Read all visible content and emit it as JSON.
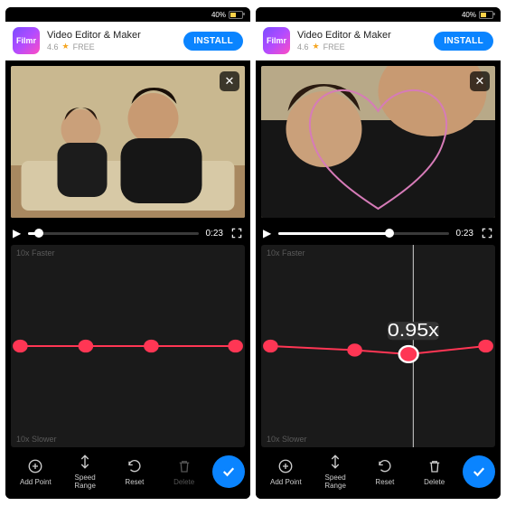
{
  "status": {
    "batteryPct": "40%"
  },
  "ad": {
    "iconText": "Filmr",
    "title": "Video Editor & Maker",
    "rating": "4.6",
    "price": "FREE",
    "cta": "INSTALL",
    "adInfo": "ⓘ",
    "adChoices": "▷"
  },
  "player": {
    "closeGlyph": "✕",
    "playGlyph": "▶",
    "fullGlyph": "⛶"
  },
  "curve": {
    "topLabel": "10x Faster",
    "bottomLabel": "10x Slower"
  },
  "toolbar": {
    "addPoint": "Add Point",
    "speedRange": "Speed\nRange",
    "reset": "Reset",
    "delete": "Delete"
  },
  "left": {
    "time": "0:23",
    "progressPct": 6,
    "points": [
      {
        "x": 4,
        "y": 50
      },
      {
        "x": 32,
        "y": 50
      },
      {
        "x": 60,
        "y": 50
      },
      {
        "x": 96,
        "y": 50
      }
    ]
  },
  "right": {
    "time": "0:23",
    "progressPct": 65,
    "playheadPct": 65,
    "speedBadge": "0.95x",
    "points": [
      {
        "x": 4,
        "y": 50
      },
      {
        "x": 40,
        "y": 52
      },
      {
        "x": 63,
        "y": 54
      },
      {
        "x": 96,
        "y": 50
      }
    ]
  }
}
